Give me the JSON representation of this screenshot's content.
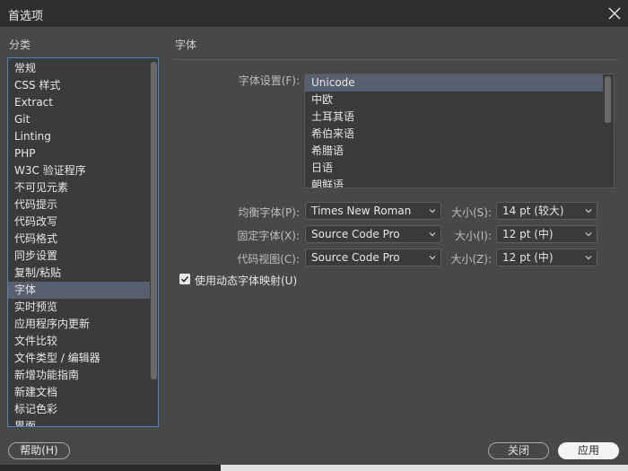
{
  "window": {
    "title": "首选项"
  },
  "category": {
    "heading": "分类",
    "items": [
      "常规",
      "CSS 样式",
      "Extract",
      "Git",
      "Linting",
      "PHP",
      "W3C 验证程序",
      "不可见元素",
      "代码提示",
      "代码改写",
      "代码格式",
      "同步设置",
      "复制/粘贴",
      "字体",
      "实时预览",
      "应用程序内更新",
      "文件比较",
      "文件类型 / 编辑器",
      "新增功能指南",
      "新建文档",
      "标记色彩",
      "界面"
    ],
    "selected": "字体"
  },
  "fonts": {
    "section_title": "字体",
    "encoding_label": "字体设置(F):",
    "encodings": [
      "Unicode",
      "中欧",
      "土耳其语",
      "希伯来语",
      "希腊语",
      "日语",
      "朝鲜语"
    ],
    "encoding_selected": "Unicode",
    "proportional_label": "均衡字体(P):",
    "proportional_value": "Times New Roman",
    "proportional_size_label": "大小(S):",
    "proportional_size": "14 pt (较大)",
    "fixed_label": "固定字体(X):",
    "fixed_value": "Source Code Pro",
    "fixed_size_label": "大小(I):",
    "fixed_size": "12 pt (中)",
    "codeview_label": "代码视图(C):",
    "codeview_value": "Source Code Pro",
    "codeview_size_label": "大小(Z):",
    "codeview_size": "12 pt (中)",
    "dynamic_mapping_label": "使用动态字体映射(U)",
    "dynamic_mapping_checked": true
  },
  "buttons": {
    "help": "帮助(H)",
    "close": "关闭",
    "apply": "应用"
  },
  "colors": {
    "selection": "#586070",
    "focus_border": "#4f84bf",
    "background": "#484848"
  }
}
